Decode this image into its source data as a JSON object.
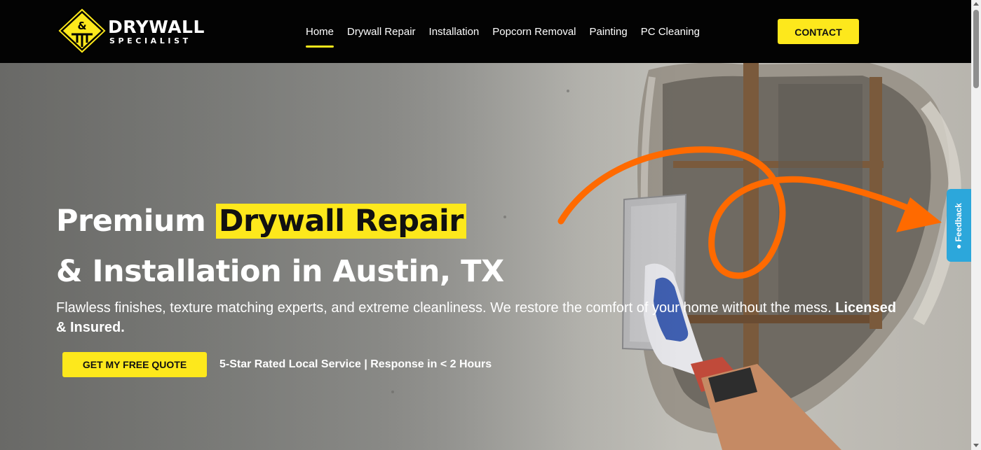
{
  "brand": {
    "logo_mark_text": "&",
    "name_line1": "DRYWALL",
    "name_line2": "SPECIALIST"
  },
  "nav": {
    "items": [
      {
        "label": "Home",
        "active": true
      },
      {
        "label": "Drywall Repair",
        "active": false
      },
      {
        "label": "Installation",
        "active": false
      },
      {
        "label": "Popcorn Removal",
        "active": false
      },
      {
        "label": "Painting",
        "active": false
      },
      {
        "label": "PC Cleaning",
        "active": false
      }
    ],
    "contact_label": "CONTACT"
  },
  "hero": {
    "headline_part1": "Premium ",
    "headline_highlight": "Drywall Repair",
    "headline_line2": "& Installation in Austin, TX",
    "subtext": "Flawless finishes, texture matching experts, and extreme cleanliness. We restore the comfort of your home without the mess. ",
    "subtext_bold": "Licensed & Insured.",
    "cta_label": "GET MY FREE QUOTE",
    "rating_text": "5-Star Rated Local Service | Response in < 2 Hours"
  },
  "feedback": {
    "label": "Feedback",
    "icon": "speech-bubble-icon"
  },
  "colors": {
    "accent_yellow": "#fde81c",
    "nav_bg": "#030303",
    "feedback_blue": "#2ca7db",
    "annotation_orange": "#ff6a00"
  }
}
